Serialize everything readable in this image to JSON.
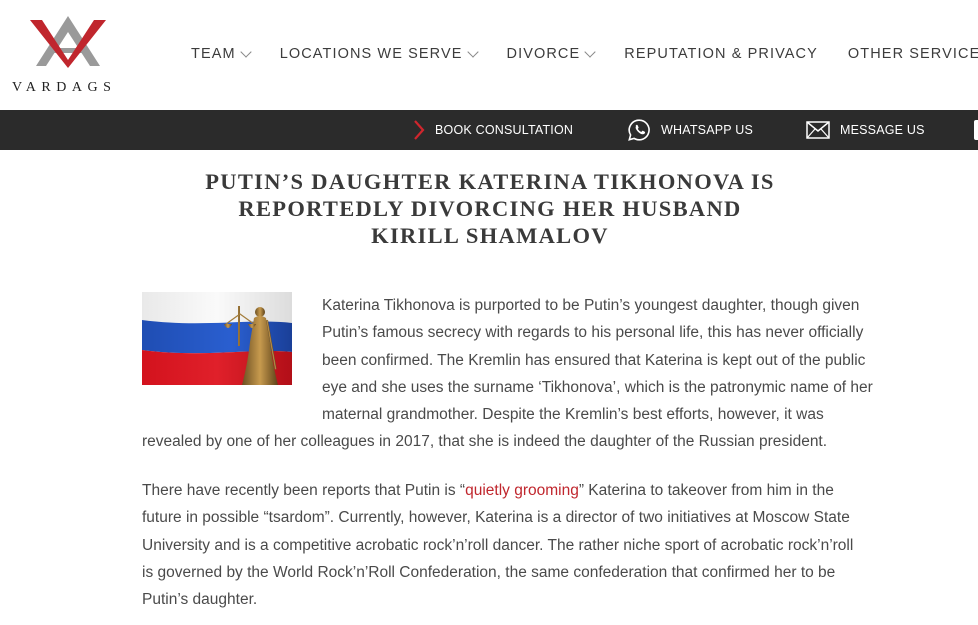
{
  "brand": {
    "logo_text": "VARDAGS",
    "colors": {
      "red": "#c0262d",
      "grey": "#9a9a9a",
      "bar": "#2b2b2b"
    }
  },
  "nav": {
    "items": [
      {
        "label": "TEAM",
        "has_dropdown": true
      },
      {
        "label": "LOCATIONS WE SERVE",
        "has_dropdown": true
      },
      {
        "label": "DIVORCE",
        "has_dropdown": true
      },
      {
        "label": "REPUTATION & PRIVACY",
        "has_dropdown": false
      },
      {
        "label": "OTHER SERVICES",
        "has_dropdown": true
      }
    ]
  },
  "action_bar": {
    "book": {
      "label": "BOOK CONSULTATION",
      "icon": "chevron-right-icon"
    },
    "whatsapp": {
      "label": "WHATSAPP US",
      "icon": "whatsapp-icon"
    },
    "message": {
      "label": "MESSAGE US",
      "icon": "envelope-icon"
    }
  },
  "article": {
    "title_lines": [
      "PUTIN’S DAUGHTER KATERINA TIKHONOVA IS",
      "REPORTEDLY DIVORCING HER HUSBAND",
      "KIRILL SHAMALOV"
    ],
    "image_icon": "russian-flag-lady-justice-image",
    "p1_lines": [
      "Katerina Tikhonova is purported to be Putin’s youngest daughter, though given",
      "Putin’s famous secrecy with regards to his personal life, this has never officially",
      "been confirmed. The Kremlin has ensured that Katerina is kept out of the public",
      "eye and she uses the surname ‘Tikhonova’, which is the patronymic name of her",
      "maternal grandmother. Despite the Kremlin’s best efforts, however, it was",
      "revealed by one of her colleagues in 2017, that she is indeed the daughter of the Russian president."
    ],
    "p2": {
      "line1_before": "There have recently been reports that Putin is “",
      "line1_link": "quietly grooming",
      "line1_after": "” Katerina to takeover from him in the",
      "lines": [
        "future in possible “tsardom”. Currently, however, Katerina is a director of two initiatives at Moscow State",
        "University and is a competitive acrobatic rock’n’roll dancer. The rather niche sport of acrobatic rock’n’roll",
        "is governed by the World Rock’n’Roll Confederation, the same confederation that confirmed her to be",
        "Putin’s daughter."
      ]
    }
  }
}
